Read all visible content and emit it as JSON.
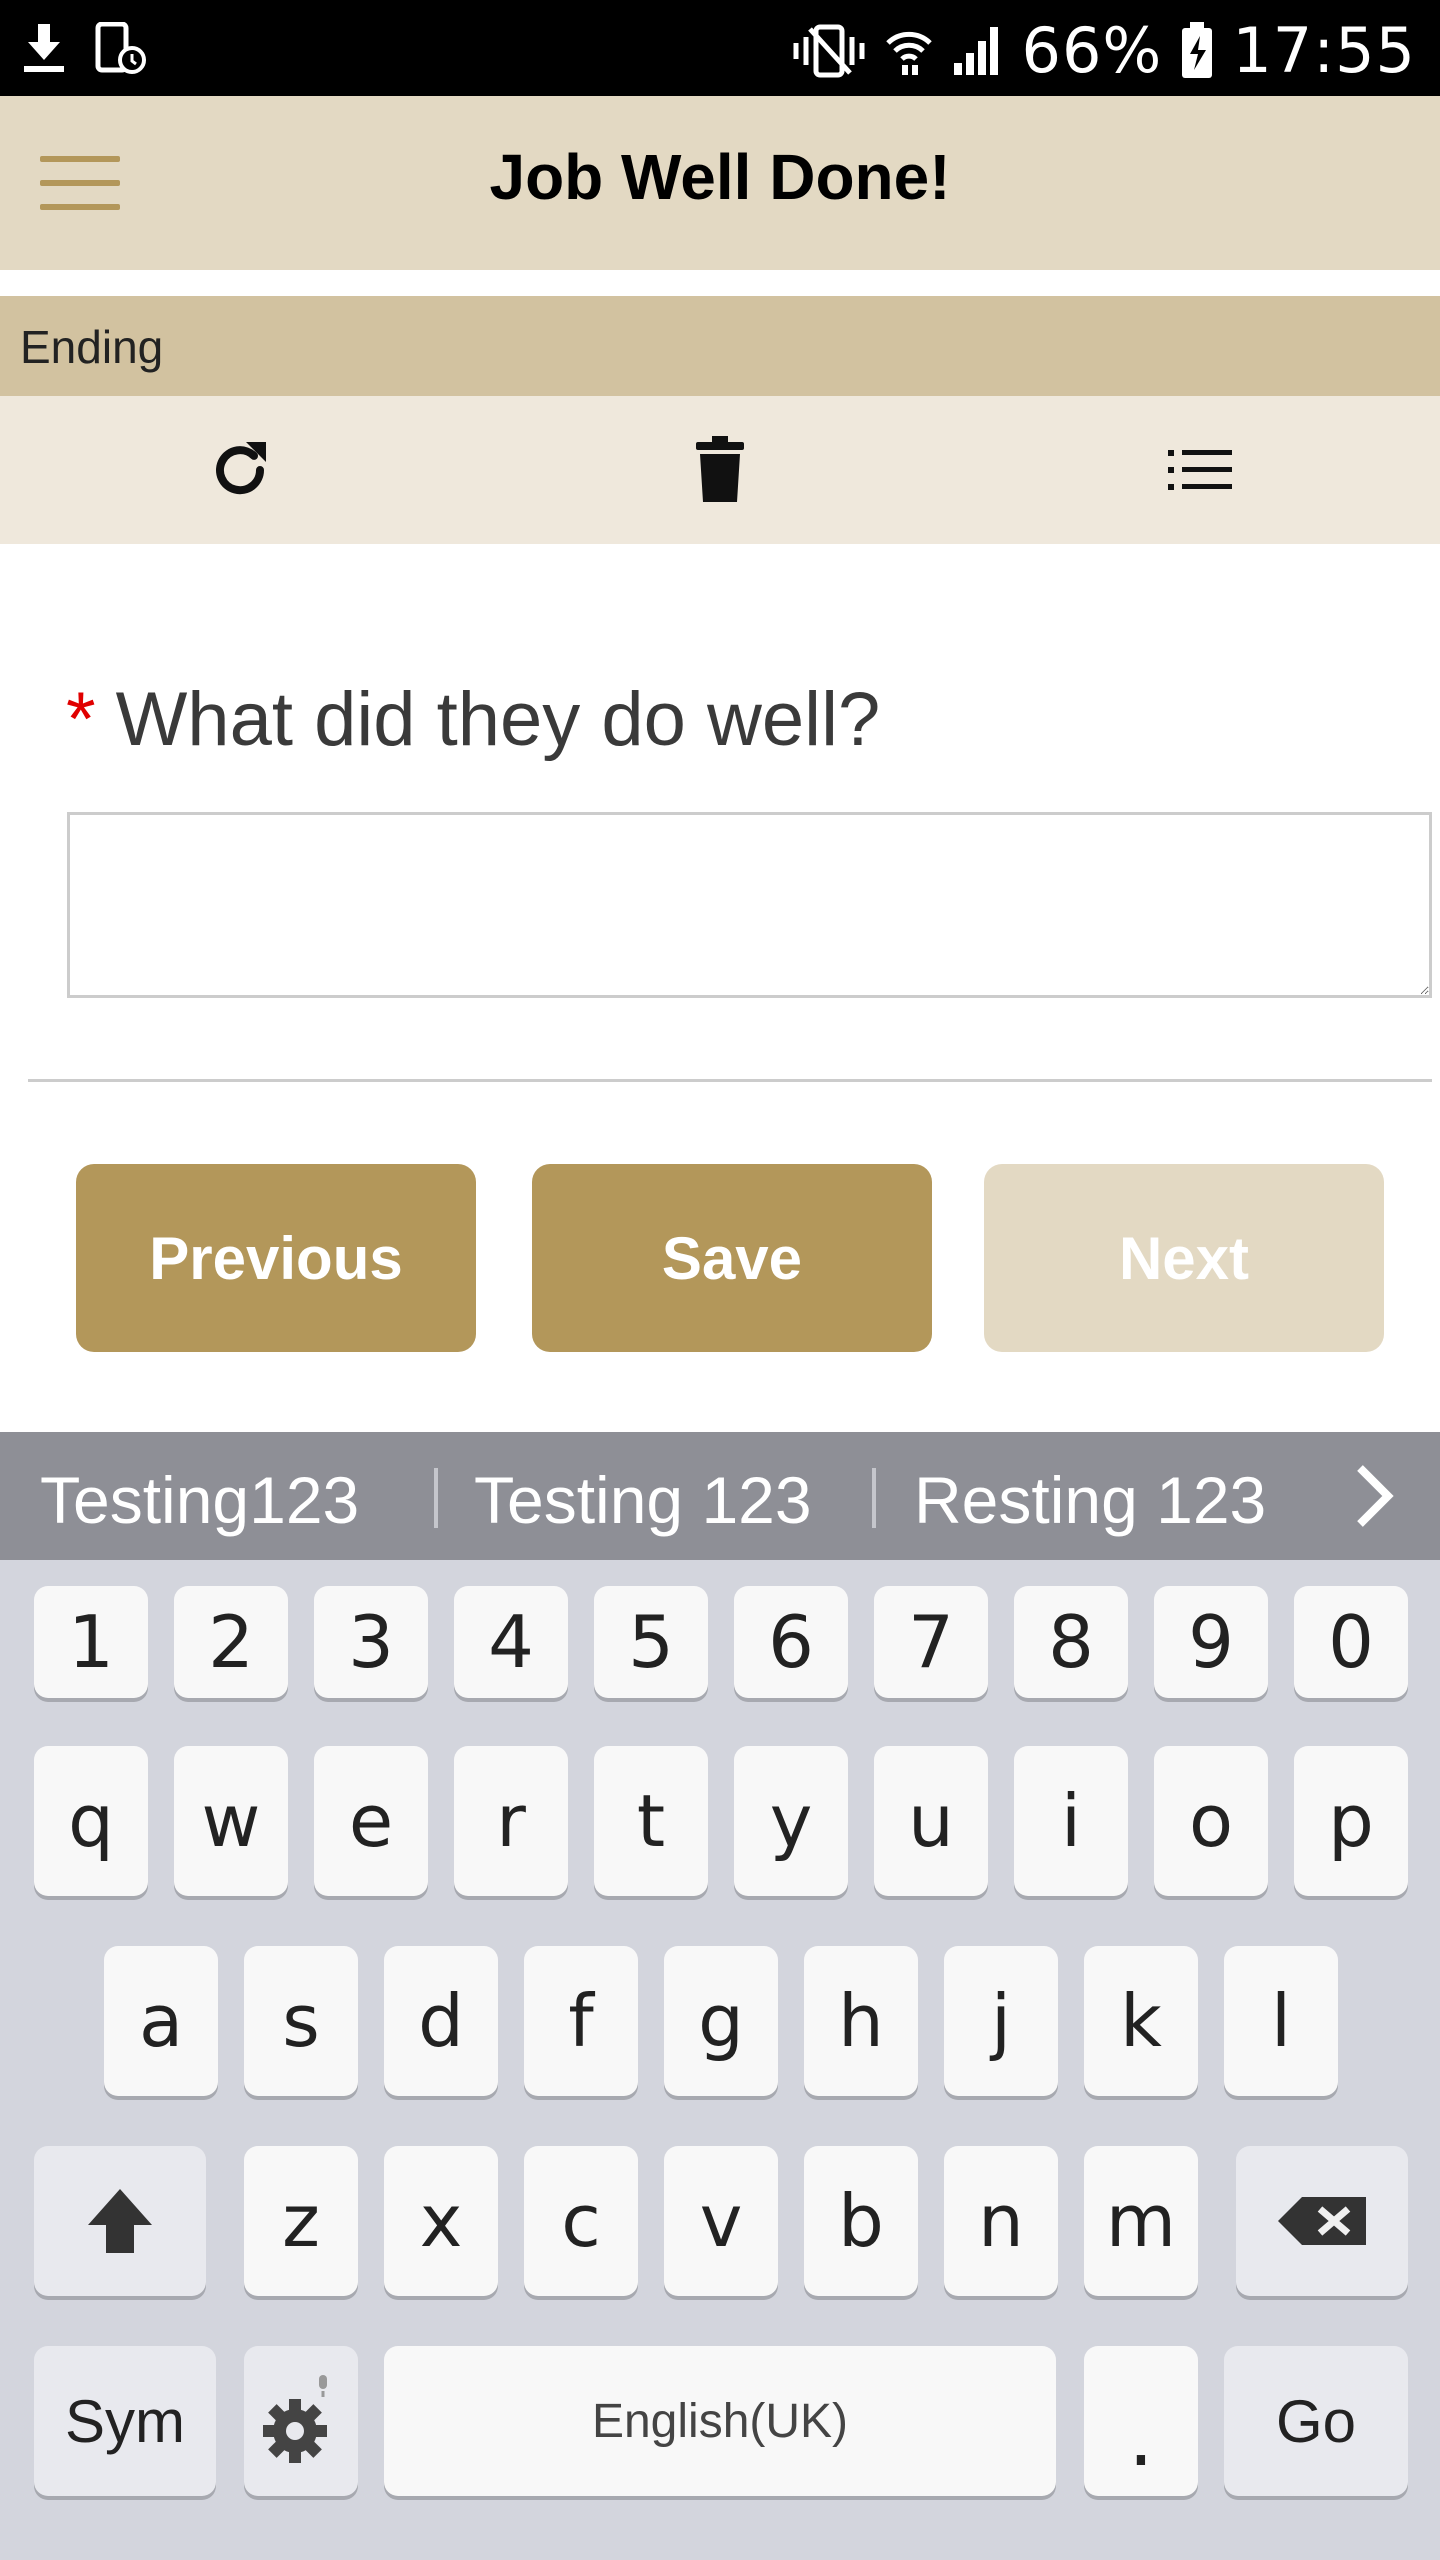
{
  "status_bar": {
    "battery": "66%",
    "time": "17:55"
  },
  "app_bar": {
    "title": "Job Well Done!"
  },
  "section": {
    "label": "Ending"
  },
  "form": {
    "question": "What did they do well?",
    "required_mark": "*",
    "answer_value": ""
  },
  "buttons": {
    "previous": "Previous",
    "save": "Save",
    "next": "Next"
  },
  "suggestions": [
    "Testing123",
    "Testing 123",
    "Resting 123"
  ],
  "keyboard": {
    "number_row": [
      "1",
      "2",
      "3",
      "4",
      "5",
      "6",
      "7",
      "8",
      "9",
      "0"
    ],
    "row1": [
      "q",
      "w",
      "e",
      "r",
      "t",
      "y",
      "u",
      "i",
      "o",
      "p"
    ],
    "row2": [
      "a",
      "s",
      "d",
      "f",
      "g",
      "h",
      "j",
      "k",
      "l"
    ],
    "row3": [
      "z",
      "x",
      "c",
      "v",
      "b",
      "n",
      "m"
    ],
    "sym": "Sym",
    "space": "English(UK)",
    "period": ".",
    "go": "Go"
  },
  "colors": {
    "accent": "#b3975a",
    "app_bar": "#e3d9c3",
    "section_bar": "#d2c2a0",
    "toolbar": "#efe8dc",
    "required": "#e00000"
  },
  "icons": {
    "toolbar": [
      "refresh-icon",
      "trash-icon",
      "list-icon"
    ],
    "status": [
      "download-icon",
      "phone-sync-icon",
      "vibrate-icon",
      "wifi-icon",
      "signal-icon",
      "battery-charging-icon"
    ]
  }
}
